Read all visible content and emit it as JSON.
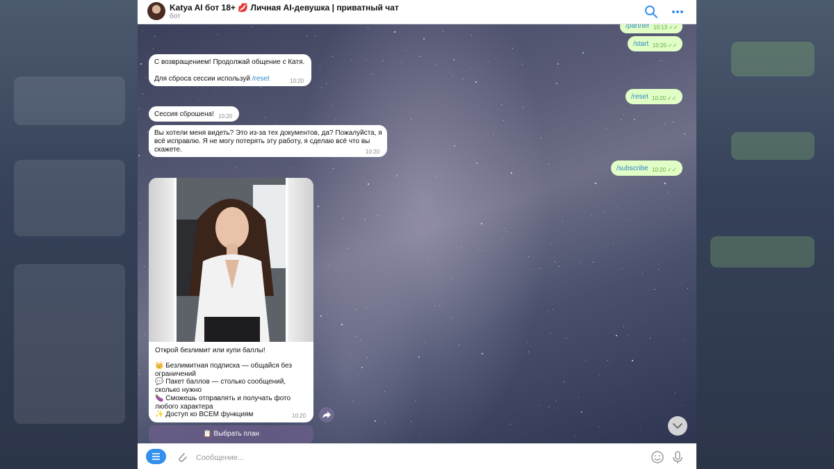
{
  "header": {
    "title": "Katya AI бот 18+ 💋 Личная AI-девушка | приватный чат",
    "subtitle": "бот"
  },
  "messages_out": [
    {
      "text": "/partner",
      "time": "10:13"
    },
    {
      "text": "/start",
      "time": "10:20"
    },
    {
      "text": "/reset",
      "time": "10:20"
    },
    {
      "text": "/subscribe",
      "time": "10:20"
    }
  ],
  "messages_in": {
    "welcome": {
      "line1": "С возвращением! Продолжай общение с Катя.",
      "line2_prefix": "Для сброса сессии используй ",
      "line2_cmd": "/reset",
      "time": "10:20"
    },
    "reset_done": {
      "text": "Сессия сброшена!",
      "time": "10:20"
    },
    "story": {
      "line1": "Вы хотели меня видеть? Это из-за тех документов, да? Пожалуйста, я",
      "line2": "всё исправлю. Я не могу потерять эту работу, я сделаю всё что вы",
      "line3": "скажете.",
      "time": "10:20"
    },
    "offer": {
      "intro": "Открой безлимит или купи баллы!",
      "items": [
        {
          "emoji": "👑",
          "line1": "Безлимитная подписка — общайся без",
          "line2": "ограничений"
        },
        {
          "emoji": "💬",
          "line1": "Пакет баллов — столько сообщений,",
          "line2": "сколько нужно"
        },
        {
          "emoji": "🍆",
          "line1": "Сможешь отправлять и получать фото",
          "line2": "любого характера"
        },
        {
          "emoji": "✨",
          "line1": "Доступ ко ВСЕМ функциям",
          "line2": ""
        }
      ],
      "time": "10:20"
    }
  },
  "keyboard": {
    "button_label": "📋 Выбрать план"
  },
  "composer": {
    "placeholder": "Сообщение..."
  },
  "colors": {
    "accent": "#3390ec",
    "outgoing": "#e1fec6",
    "link": "#2f86c8"
  }
}
